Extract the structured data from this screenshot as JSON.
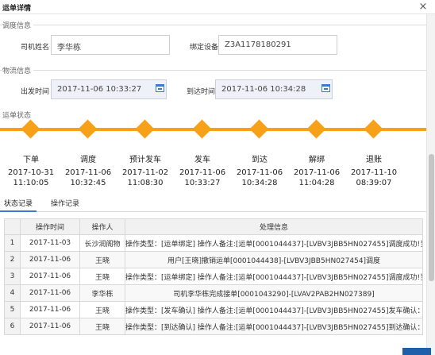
{
  "window": {
    "title": "运单详情",
    "close_symbol": "×"
  },
  "dispatch": {
    "section_title": "调度信息",
    "driver_label": "司机姓名",
    "driver_value": "李华栋",
    "device_label": "绑定设备",
    "device_value": "Z3A1178180291"
  },
  "logistics": {
    "section_title": "物流信息",
    "depart_label": "出发时间",
    "depart_value": "2017-11-06 10:33:27",
    "arrive_label": "到达时间",
    "arrive_value": "2017-11-06 10:34:28"
  },
  "status": {
    "section_title": "运单状态",
    "stages": [
      {
        "name": "下单",
        "date": "2017-10-31",
        "time": "11:10:05"
      },
      {
        "name": "调度",
        "date": "2017-11-06",
        "time": "10:32:45"
      },
      {
        "name": "预计发车",
        "date": "2017-11-02",
        "time": "11:08:30"
      },
      {
        "name": "发车",
        "date": "2017-11-06",
        "time": "10:33:27"
      },
      {
        "name": "到达",
        "date": "2017-11-06",
        "time": "10:34:28"
      },
      {
        "name": "解绑",
        "date": "2017-11-06",
        "time": "11:04:28"
      },
      {
        "name": "退账",
        "date": "2017-11-10",
        "time": "08:39:07"
      }
    ]
  },
  "tabs": [
    {
      "label": "状态记录",
      "active": true
    },
    {
      "label": "操作记录",
      "active": false
    }
  ],
  "table": {
    "headers": [
      "",
      "操作时间",
      "操作人",
      "处理信息"
    ],
    "rows": [
      {
        "no": "1",
        "time": "2017-11-03",
        "operator": "长沙润阁物",
        "info": "操作类型：[运单绑定] 操作人备注:[运单[0001044437]-[LVBV3JBB5HN027455]调度成功!当前选"
      },
      {
        "no": "2",
        "time": "2017-11-06",
        "operator": "王晓",
        "info": "用户[王晓]撤销运单[0001044438]-[LVBV3JBB5HN027454]调度"
      },
      {
        "no": "3",
        "time": "2017-11-06",
        "operator": "王晓",
        "info": "操作类型：[运单绑定] 操作人备注:[运单[0001044437]-[LVBV3JBB5HN027455]调度成功!当前选"
      },
      {
        "no": "4",
        "time": "2017-11-06",
        "operator": "李华栋",
        "info": "司机李华栋完成接单[0001043290]-[LVAV2PAB2HN027389]"
      },
      {
        "no": "5",
        "time": "2017-11-06",
        "operator": "王晓",
        "info": "操作类型：[发车确认] 操作人备注:[运单[0001044437]-[LVBV3JBB5HN027455]发车确认：当前设"
      },
      {
        "no": "6",
        "time": "2017-11-06",
        "operator": "王晓",
        "info": "操作类型：[到达确认] 操作人备注:[运单[0001044437]-[LVBV3JBB5HN027455]到达确认：当前设"
      }
    ]
  },
  "colors": {
    "timeline": "#f7a11a",
    "accent": "#3b7bcc"
  }
}
